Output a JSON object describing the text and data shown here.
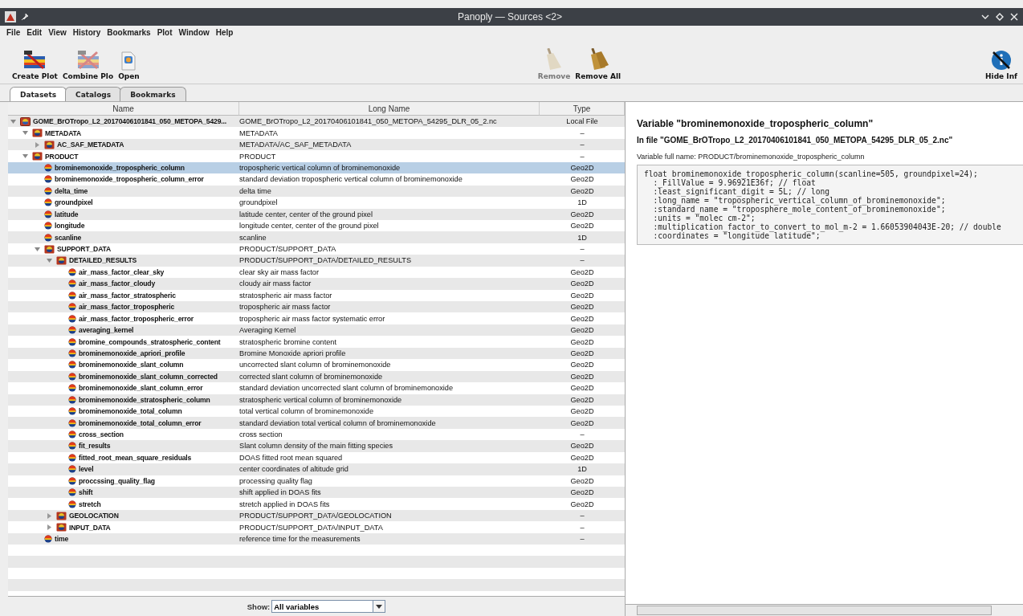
{
  "window": {
    "title": "Panoply — Sources <2>"
  },
  "menu": [
    "File",
    "Edit",
    "View",
    "History",
    "Bookmarks",
    "Plot",
    "Window",
    "Help"
  ],
  "toolbar": [
    {
      "kind": "create",
      "label": "Create Plot",
      "disabled": false
    },
    {
      "kind": "combine",
      "label": "Combine Plo",
      "disabled": false
    },
    {
      "kind": "open",
      "label": "Open",
      "disabled": false
    },
    {
      "kind": "remove",
      "label": "Remove",
      "disabled": true
    },
    {
      "kind": "remove_all",
      "label": "Remove All",
      "disabled": false
    },
    {
      "kind": "hide_info",
      "label": "Hide Inf",
      "disabled": false
    }
  ],
  "tabs": [
    {
      "label": "Datasets",
      "selected": true
    },
    {
      "label": "Catalogs",
      "selected": false
    },
    {
      "label": "Bookmarks",
      "selected": false
    }
  ],
  "table": {
    "columns": [
      "Name",
      "Long Name",
      "Type"
    ],
    "tree": [
      {
        "kind": "file",
        "name": "GOME_BrOTropo_L2_20170406101841_050_METOPA_5429...",
        "long_name": "GOME_BrOTropo_L2_20170406101841_050_METOPA_54295_DLR_05_2.nc",
        "type": "Local File",
        "expanded": true,
        "selected": false,
        "children": [
          {
            "kind": "group",
            "name": "METADATA",
            "long_name": "METADATA",
            "type": "–",
            "expanded": true,
            "selected": false,
            "children": [
              {
                "kind": "group",
                "name": "AC_SAF_METADATA",
                "long_name": "METADATA/AC_SAF_METADATA",
                "type": "–",
                "expanded": false,
                "selected": false
              }
            ]
          },
          {
            "kind": "group",
            "name": "PRODUCT",
            "long_name": "PRODUCT",
            "type": "–",
            "expanded": true,
            "selected": false,
            "children": [
              {
                "kind": "variable",
                "name": "brominemonoxide_tropospheric_column",
                "long_name": "tropospheric vertical column of brominemonoxide",
                "type": "Geo2D",
                "selected": true
              },
              {
                "kind": "variable",
                "name": "brominemonoxide_tropospheric_column_error",
                "long_name": "standard deviation tropospheric vertical column of brominemonoxide",
                "type": "Geo2D",
                "selected": false
              },
              {
                "kind": "variable",
                "name": "delta_time",
                "long_name": "delta time",
                "type": "Geo2D",
                "selected": false
              },
              {
                "kind": "variable",
                "name": "groundpixel",
                "long_name": "groundpixel",
                "type": "1D",
                "selected": false
              },
              {
                "kind": "variable",
                "name": "latitude",
                "long_name": "latitude center, center of the ground pixel",
                "type": "Geo2D",
                "selected": false
              },
              {
                "kind": "variable",
                "name": "longitude",
                "long_name": "longitude center, center of the ground pixel",
                "type": "Geo2D",
                "selected": false
              },
              {
                "kind": "variable",
                "name": "scanline",
                "long_name": "scanline",
                "type": "1D",
                "selected": false
              },
              {
                "kind": "group",
                "name": "SUPPORT_DATA",
                "long_name": "PRODUCT/SUPPORT_DATA",
                "type": "–",
                "expanded": true,
                "selected": false,
                "children": [
                  {
                    "kind": "group",
                    "name": "DETAILED_RESULTS",
                    "long_name": "PRODUCT/SUPPORT_DATA/DETAILED_RESULTS",
                    "type": "–",
                    "expanded": true,
                    "selected": false,
                    "children": [
                      {
                        "kind": "variable",
                        "name": "air_mass_factor_clear_sky",
                        "long_name": "clear sky air mass factor",
                        "type": "Geo2D",
                        "selected": false
                      },
                      {
                        "kind": "variable",
                        "name": "air_mass_factor_cloudy",
                        "long_name": "cloudy air mass factor",
                        "type": "Geo2D",
                        "selected": false
                      },
                      {
                        "kind": "variable",
                        "name": "air_mass_factor_stratospheric",
                        "long_name": "stratospheric air mass factor",
                        "type": "Geo2D",
                        "selected": false
                      },
                      {
                        "kind": "variable",
                        "name": "air_mass_factor_tropospheric",
                        "long_name": "tropospheric air mass factor",
                        "type": "Geo2D",
                        "selected": false
                      },
                      {
                        "kind": "variable",
                        "name": "air_mass_factor_tropospheric_error",
                        "long_name": "tropospheric air mass factor systematic error",
                        "type": "Geo2D",
                        "selected": false
                      },
                      {
                        "kind": "variable",
                        "name": "averaging_kernel",
                        "long_name": "Averaging Kernel",
                        "type": "Geo2D",
                        "selected": false
                      },
                      {
                        "kind": "variable",
                        "name": "bromine_compounds_stratospheric_content",
                        "long_name": "stratospheric bromine content",
                        "type": "Geo2D",
                        "selected": false
                      },
                      {
                        "kind": "variable",
                        "name": "brominemonoxide_apriori_profile",
                        "long_name": "Bromine Monoxide apriori profile",
                        "type": "Geo2D",
                        "selected": false
                      },
                      {
                        "kind": "variable",
                        "name": "brominemonoxide_slant_column",
                        "long_name": "uncorrected slant column of brominemonoxide",
                        "type": "Geo2D",
                        "selected": false
                      },
                      {
                        "kind": "variable",
                        "name": "brominemonoxide_slant_column_corrected",
                        "long_name": "corrected slant column of brominemonoxide",
                        "type": "Geo2D",
                        "selected": false
                      },
                      {
                        "kind": "variable",
                        "name": "brominemonoxide_slant_column_error",
                        "long_name": "standard deviation uncorrected slant column of brominemonoxide",
                        "type": "Geo2D",
                        "selected": false
                      },
                      {
                        "kind": "variable",
                        "name": "brominemonoxide_stratospheric_column",
                        "long_name": "stratospheric vertical column of brominemonoxide",
                        "type": "Geo2D",
                        "selected": false
                      },
                      {
                        "kind": "variable",
                        "name": "brominemonoxide_total_column",
                        "long_name": "total vertical column of brominemonoxide",
                        "type": "Geo2D",
                        "selected": false
                      },
                      {
                        "kind": "variable",
                        "name": "brominemonoxide_total_column_error",
                        "long_name": "standard deviation total vertical column of brominemonoxide",
                        "type": "Geo2D",
                        "selected": false
                      },
                      {
                        "kind": "variable",
                        "name": "cross_section",
                        "long_name": "cross section",
                        "type": "–",
                        "selected": false
                      },
                      {
                        "kind": "variable",
                        "name": "fit_results",
                        "long_name": "Slant column density of the main fitting species",
                        "type": "Geo2D",
                        "selected": false
                      },
                      {
                        "kind": "variable",
                        "name": "fitted_root_mean_square_residuals",
                        "long_name": "DOAS fitted root mean squared",
                        "type": "Geo2D",
                        "selected": false
                      },
                      {
                        "kind": "variable",
                        "name": "level",
                        "long_name": "center coordinates of altitude grid",
                        "type": "1D",
                        "selected": false
                      },
                      {
                        "kind": "variable",
                        "name": "proccssing_quality_flag",
                        "long_name": "processing quality flag",
                        "type": "Geo2D",
                        "selected": false
                      },
                      {
                        "kind": "variable",
                        "name": "shift",
                        "long_name": "shift applied in DOAS fits",
                        "type": "Geo2D",
                        "selected": false
                      },
                      {
                        "kind": "variable",
                        "name": "stretch",
                        "long_name": "stretch applied in DOAS fits",
                        "type": "Geo2D",
                        "selected": false
                      }
                    ]
                  },
                  {
                    "kind": "group",
                    "name": "GEOLOCATION",
                    "long_name": "PRODUCT/SUPPORT_DATA/GEOLOCATION",
                    "type": "–",
                    "expanded": false,
                    "selected": false
                  },
                  {
                    "kind": "group",
                    "name": "INPUT_DATA",
                    "long_name": "PRODUCT/SUPPORT_DATA/INPUT_DATA",
                    "type": "–",
                    "expanded": false,
                    "selected": false
                  }
                ]
              },
              {
                "kind": "variable",
                "name": "time",
                "long_name": "reference time for the measurements",
                "type": "–",
                "selected": false
              }
            ]
          }
        ]
      }
    ]
  },
  "filter": {
    "label": "Show:",
    "value": "All variables"
  },
  "info": {
    "title": "Variable \"brominemonoxide_tropospheric_column\"",
    "file": "In file \"GOME_BrOTropo_L2_20170406101841_050_METOPA_54295_DLR_05_2.nc\"",
    "full_name": "Variable full name: PRODUCT/brominemonoxide_tropospheric_column",
    "code": [
      "float brominemonoxide_tropospheric_column(scanline=505, groundpixel=24);",
      "  :_FillValue = 9.96921E36f; // float",
      "  :least_significant_digit = 5L; // long",
      "  :long_name = \"tropospheric_vertical_column_of_brominemonoxide\";",
      "  :standard_name = \"troposphere_mole_content_of_brominemonoxide\";",
      "  :units = \"molec cm-2\";",
      "  :multiplication_factor_to_convert_to_mol_m-2 = 1.66053904043E-20; // double",
      "  :coordinates = \"longitude latitude\";"
    ]
  }
}
